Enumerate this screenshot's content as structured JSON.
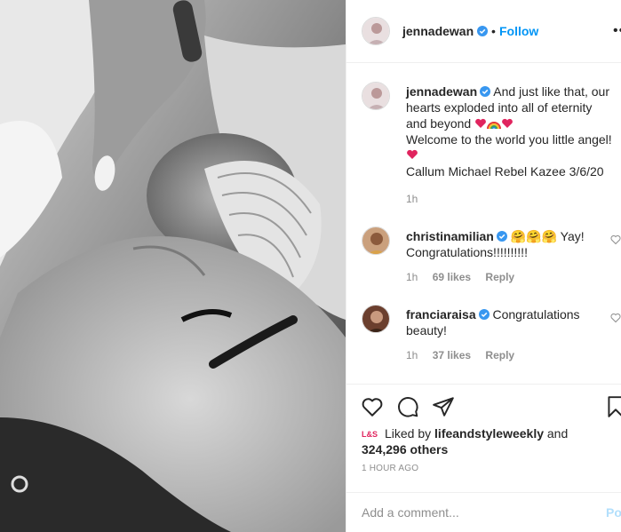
{
  "post": {
    "author": "jennadewan",
    "follow_label": "Follow",
    "separator": "•",
    "more_label": "••"
  },
  "caption": {
    "username": "jennadewan",
    "line1": "And just like that, our hearts exploded into all of eternity and beyond",
    "line2": "Welcome to the world you little angel!",
    "line3": "Callum Michael Rebel Kazee 3/6/20",
    "time": "1h"
  },
  "comments": [
    {
      "username": "christinamilian",
      "emoji": "🤗🤗🤗",
      "text": "Yay! Congratulations!!!!!!!!!!",
      "time": "1h",
      "likes": "69 likes",
      "reply": "Reply"
    },
    {
      "username": "franciaraisa",
      "text": "Congratulations beauty!",
      "time": "1h",
      "likes": "37 likes",
      "reply": "Reply"
    }
  ],
  "likes": {
    "prefix": "Liked by",
    "user": "lifeandstyleweekly",
    "and": "and",
    "others": "324,296 others",
    "logo": "L&S"
  },
  "timestamp": "1 HOUR AGO",
  "add_comment": {
    "placeholder": "Add a comment...",
    "post_label": "Post"
  },
  "colors": {
    "link": "#0095f6",
    "verified": "#3897f0",
    "muted": "#8e8e8e",
    "heart": "#ed4956"
  },
  "icons": [
    "heart-icon",
    "comment-icon",
    "share-icon",
    "bookmark-icon",
    "verified-badge-icon",
    "rainbow-emoji",
    "small-heart-icon"
  ]
}
